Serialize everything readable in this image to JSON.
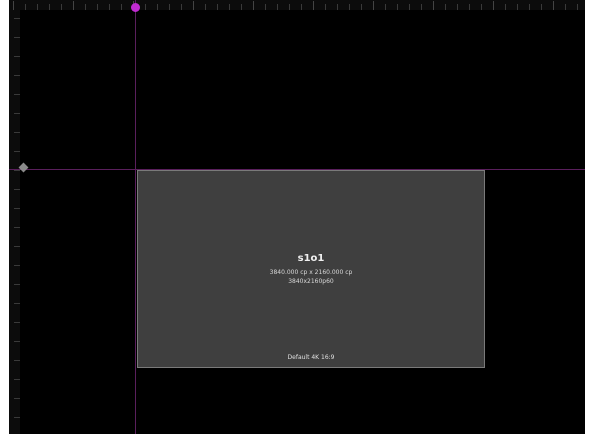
{
  "canvas": {
    "screen": {
      "title": "s1o1",
      "size_text": "3840.000 cp x 2160.000 cp",
      "format_text": "3840x2160p60",
      "preset_text": "Default 4K 16:9"
    },
    "colors": {
      "background": "#000000",
      "guide": "#5a1f5c",
      "guide_marker": "#c02ad0",
      "screen_fill": "#3f3f3f",
      "screen_border": "#7a7a7a"
    }
  }
}
